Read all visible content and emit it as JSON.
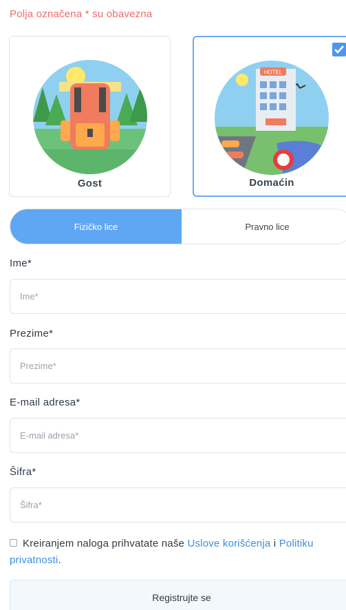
{
  "required_note": "Polja označena * su obavezna",
  "user_types": {
    "guest": {
      "label": "Gost",
      "selected": false,
      "illustration": "backpack-illustration"
    },
    "host": {
      "label": "Domaćin",
      "selected": true,
      "illustration": "hotel-illustration",
      "sign_text": "HOTEL"
    }
  },
  "entity_toggle": {
    "active": "Fizičko lice",
    "inactive": "Pravno lice"
  },
  "fields": {
    "first_name": {
      "label": "Ime*",
      "placeholder": "Ime*"
    },
    "last_name": {
      "label": "Prezime*",
      "placeholder": "Prezime*"
    },
    "email": {
      "label": "E-mail adresa*",
      "placeholder": "E-mail adresa*"
    },
    "password": {
      "label": "Šifra*",
      "placeholder": "Šifra*"
    }
  },
  "terms": {
    "prefix": "Kreiranjem naloga prihvatate naše",
    "link_terms": "Uslove korišćenja",
    "joiner": "i",
    "link_privacy": "Politiku privatnosti",
    "suffix": "."
  },
  "submit_label": "Registrujte se",
  "colors": {
    "accent": "#5fa6f3",
    "required": "#ef6a6a",
    "link": "#3b8fe0"
  }
}
